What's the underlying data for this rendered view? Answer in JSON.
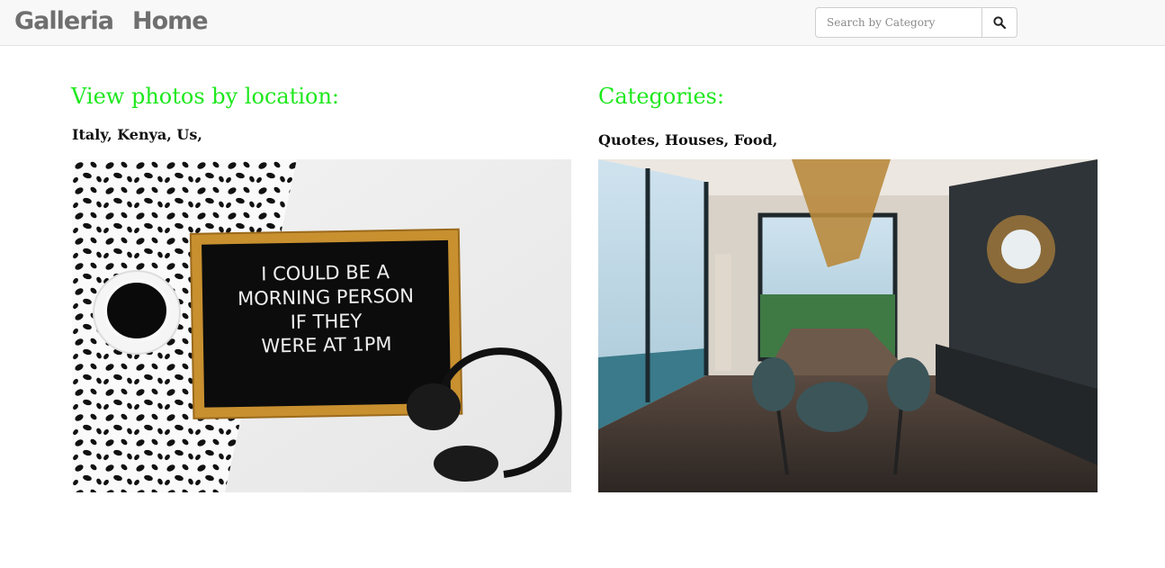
{
  "navbar": {
    "brand": "Galleria",
    "home": "Home",
    "search_placeholder": "Search by Category",
    "search_icon": "search-icon"
  },
  "locations": {
    "title": "View photos by location:",
    "items": [
      "Italy,",
      "Kenya,",
      "Us,"
    ],
    "photo_text": [
      "I COULD BE A",
      "MORNING PERSON",
      "IF THEY",
      "WERE AT 1PM"
    ]
  },
  "categories": {
    "title": "Categories:",
    "items": [
      "Quotes,",
      "Houses,",
      "Food,"
    ]
  },
  "colors": {
    "accent_green": "#1ee81e",
    "navbar_bg": "#f8f8f8",
    "nav_text": "#6f6f6f"
  }
}
